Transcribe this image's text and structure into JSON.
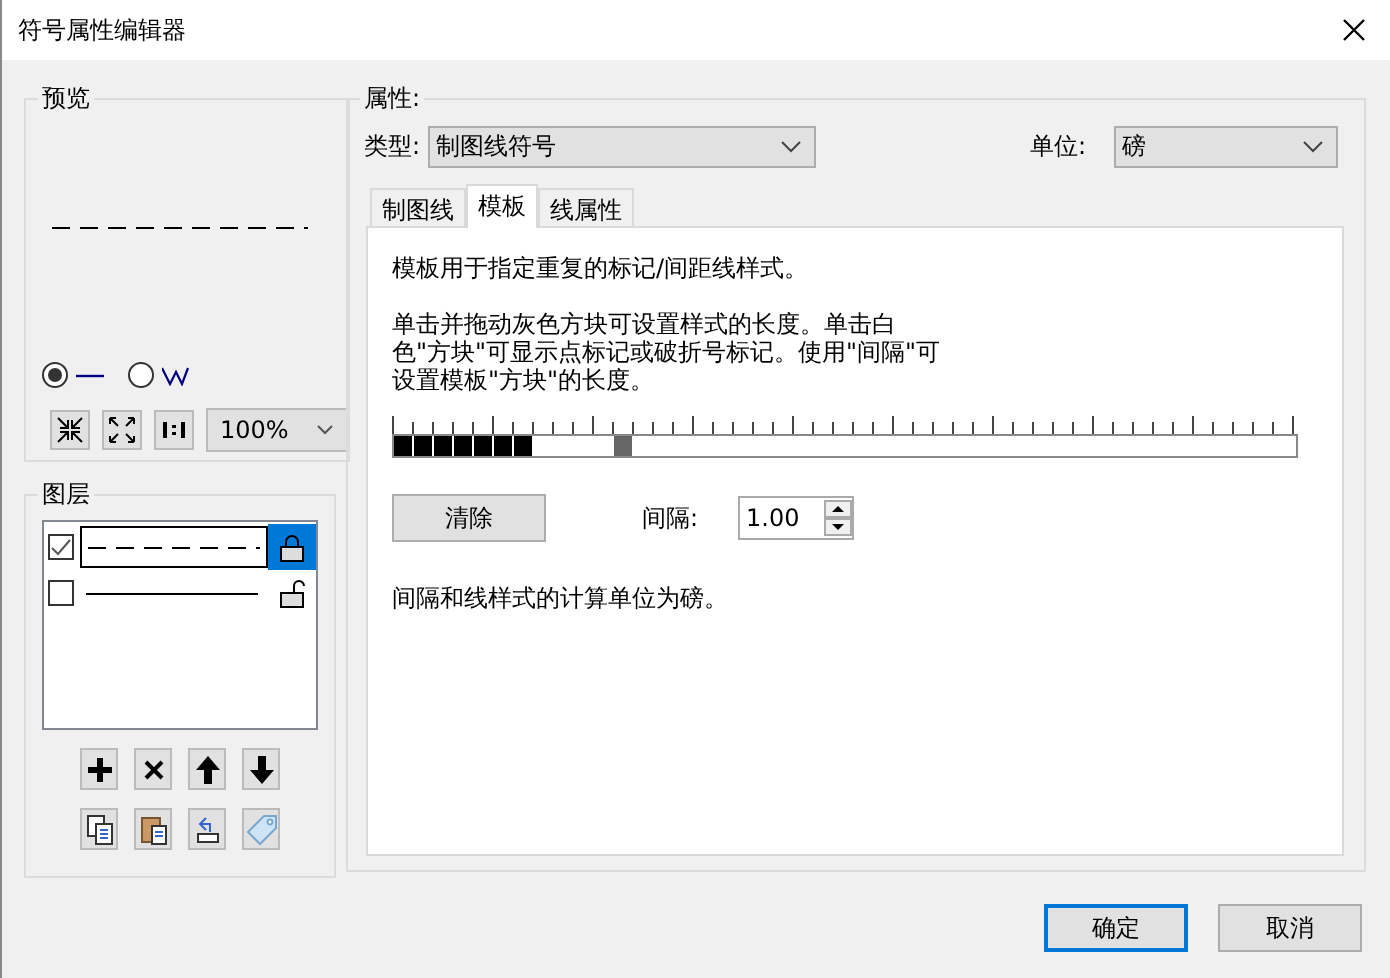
{
  "window": {
    "title": "符号属性编辑器"
  },
  "preview": {
    "title": "预览",
    "zoom": "100%",
    "modes": [
      {
        "kind": "line",
        "selected": true
      },
      {
        "kind": "zigzag",
        "selected": false
      }
    ]
  },
  "layers": {
    "title": "图层",
    "items": [
      {
        "kind": "dashed",
        "checked": true,
        "selected": true,
        "locked": true
      },
      {
        "kind": "solid",
        "checked": false,
        "selected": false,
        "locked": false
      }
    ]
  },
  "properties": {
    "title": "属性:",
    "type_label": "类型:",
    "type_value": "制图线符号",
    "unit_label": "单位:",
    "unit_value": "磅",
    "tabs": [
      {
        "label": "制图线",
        "selected": false
      },
      {
        "label": "模板",
        "selected": true
      },
      {
        "label": "线属性",
        "selected": false
      }
    ],
    "intro": "模板用于指定重复的标记/间距线样式。",
    "help": "单击并拖动灰色方块可设置样式的长度。单击白色\"方块\"可显示点标记或破折号标记。使用\"间隔\"可设置模板\"方块\"的长度。",
    "template": [
      {
        "filled": true
      },
      {
        "filled": true
      },
      {
        "filled": true
      },
      {
        "filled": true
      },
      {
        "filled": true
      },
      {
        "filled": true
      },
      {
        "filled": true
      },
      {
        "filled": false
      },
      {
        "filled": false
      },
      {
        "filled": false
      },
      {
        "filled": false
      }
    ],
    "clear_button": "清除",
    "interval_label": "间隔:",
    "interval_value": "1.00",
    "footnote": "间隔和线样式的计算单位为磅。"
  },
  "buttons": [
    {
      "label": "确定",
      "default": true
    },
    {
      "label": "取消",
      "default": false
    }
  ]
}
